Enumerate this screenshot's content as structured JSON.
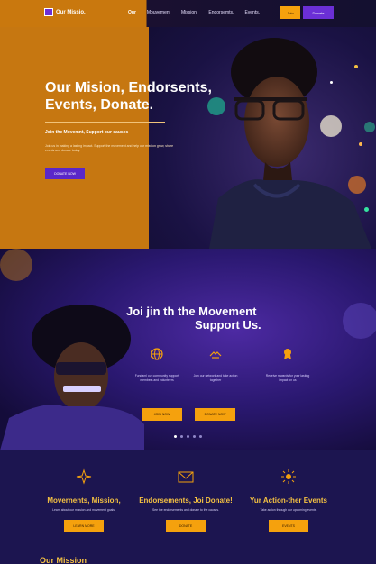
{
  "brand": {
    "name": "Our Missio."
  },
  "nav": {
    "links": [
      "Our",
      "Mouvement",
      "Mission.",
      "Endorsemts.",
      "Events.",
      "Donate"
    ],
    "cta_secondary": "Join",
    "cta_primary": "Donate"
  },
  "hero": {
    "title": "Our Mision, Endorsents,\nEvents,        Donate.",
    "subtitle": "Join the Movemnt, Support our causes",
    "body": "Join us in making a lasting impact. Support the movement and help our mission grow, share events and donate today.",
    "cta": "DONATE NOW"
  },
  "movement": {
    "title_line1": "Joi jin th the Movement",
    "title_line2": "Support Us.",
    "features": [
      {
        "icon": "globe-icon",
        "text": "Fundaml our community support members and volunteers"
      },
      {
        "icon": "handshake-icon",
        "text": "Join our network and take action together"
      },
      {
        "icon": "award-icon",
        "text": "Receive rewards for your lasting impact on us"
      }
    ],
    "btn_left": "JOIN NOW",
    "btn_right": "DONATE NOW"
  },
  "cards": [
    {
      "icon": "sparkle-icon",
      "title": "Movernents, Mission,",
      "text": "Learn about our mission and movement goals.",
      "button": "LEARN MORE"
    },
    {
      "icon": "envelope-icon",
      "title": "Endorsements, Joi Donate!",
      "text": "See the endorsements and donate to the causes.",
      "button": "DONATE"
    },
    {
      "icon": "sunburst-icon",
      "title": "Yur Action-ther Events",
      "text": "Take action through our upcoming events.",
      "button": "EVENTS"
    }
  ],
  "footer": {
    "heading": "Our Mission"
  },
  "colors": {
    "orange": "#c67711",
    "purple": "#6b2fd6",
    "gold": "#f5a10d",
    "navy": "#1c1550"
  }
}
